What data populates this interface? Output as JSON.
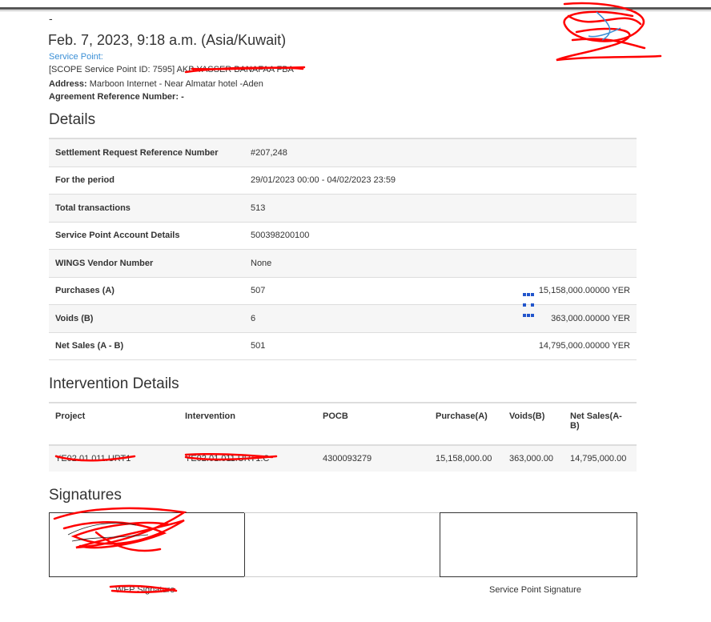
{
  "header": {
    "dash": "-",
    "date": "Feb. 7, 2023, 9:18 a.m. (Asia/Kuwait)",
    "service_point_label": "Service Point:",
    "service_point_id": "[SCOPE Service Point ID: 7595] AKB YASSER BANAFAA FBA",
    "address_label": "Address:",
    "address_value": "Marboon Internet - Near Almatar hotel -Aden",
    "agreement_label": "Agreement Reference Number:",
    "agreement_value": "-"
  },
  "details": {
    "title": "Details",
    "rows": [
      {
        "label": "Settlement Request Reference Number",
        "value": "#207,248",
        "amount": ""
      },
      {
        "label": "For the period",
        "value": "29/01/2023 00:00 - 04/02/2023 23:59",
        "amount": ""
      },
      {
        "label": "Total transactions",
        "value": "513",
        "amount": ""
      },
      {
        "label": "Service Point Account Details",
        "value": "500398200100",
        "amount": ""
      },
      {
        "label": "WINGS Vendor Number",
        "value": "None",
        "amount": ""
      },
      {
        "label": "Purchases (A)",
        "value": "507",
        "amount": "15,158,000.00000 YER"
      },
      {
        "label": "Voids (B)",
        "value": "6",
        "amount": "363,000.00000 YER"
      },
      {
        "label": "Net Sales (A - B)",
        "value": "501",
        "amount": "14,795,000.00000 YER"
      }
    ]
  },
  "intervention": {
    "title": "Intervention Details",
    "headers": [
      "Project",
      "Intervention",
      "POCB",
      "Purchase(A)",
      "Voids(B)",
      "Net Sales(A-B)"
    ],
    "row": [
      "YE02.01.011.URT1",
      "YE02.01.011.URT1.C",
      "4300093279",
      "15,158,000.00",
      "363,000.00",
      "14,795,000.00"
    ]
  },
  "signatures": {
    "title": "Signatures",
    "left_label": "WFP Signature",
    "right_label": "Service Point Signature"
  },
  "colors": {
    "link": "#3a8fd6",
    "redaction": "#ff0000",
    "row_stripe": "#f6f6f6"
  }
}
